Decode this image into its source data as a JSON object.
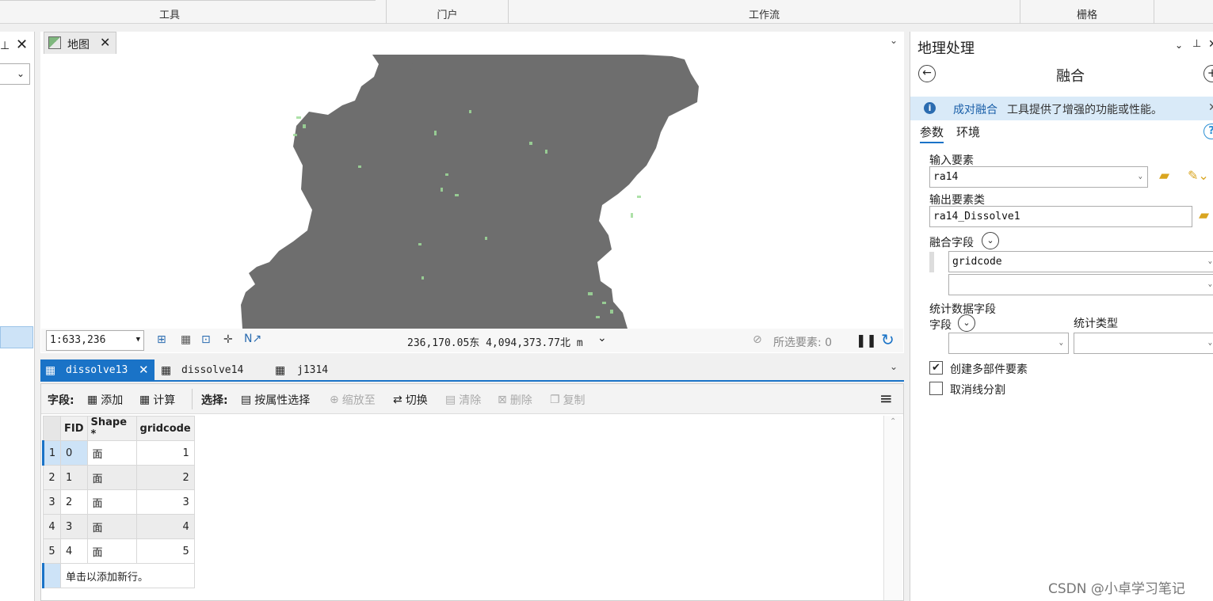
{
  "ribbon": {
    "groups": [
      "工具",
      "门户",
      "工作流",
      "栅格"
    ]
  },
  "map": {
    "tab_label": "地图",
    "scale": "1:633,236",
    "coords": "236,170.05东  4,094,373.77北 m",
    "selected_label": "所选要素: 0"
  },
  "table": {
    "tabs": [
      "dissolve13",
      "dissolve14",
      "j1314"
    ],
    "toolbar": {
      "field_label": "字段:",
      "add": "添加",
      "calculate": "计算",
      "select_label": "选择:",
      "select_by_attr": "按属性选择",
      "zoom_to": "缩放至",
      "switch": "切换",
      "clear": "清除",
      "delete": "删除",
      "copy": "复制"
    },
    "columns": [
      "FID",
      "Shape *",
      "gridcode"
    ],
    "rows": [
      {
        "num": "1",
        "fid": "0",
        "shape": "面",
        "gridcode": "1"
      },
      {
        "num": "2",
        "fid": "1",
        "shape": "面",
        "gridcode": "2"
      },
      {
        "num": "3",
        "fid": "2",
        "shape": "面",
        "gridcode": "3"
      },
      {
        "num": "4",
        "fid": "3",
        "shape": "面",
        "gridcode": "4"
      },
      {
        "num": "5",
        "fid": "4",
        "shape": "面",
        "gridcode": "5"
      }
    ],
    "add_row_hint": "单击以添加新行。"
  },
  "gp": {
    "panel_title": "地理处理",
    "tool_title": "融合",
    "info_link": "成对融合",
    "info_text": "工具提供了增强的功能或性能。",
    "tabs": [
      "参数",
      "环境"
    ],
    "input_label": "输入要素",
    "input_value": "ra14",
    "output_label": "输出要素类",
    "output_value": "ra14_Dissolve1",
    "dissolve_field_label": "融合字段",
    "dissolve_field_value": "gridcode",
    "stats_label": "统计数据字段",
    "field_label": "字段",
    "stat_type_label": "统计类型",
    "multipart_label": "创建多部件要素",
    "multipart_checked": true,
    "unsplit_label": "取消线分割",
    "unsplit_checked": false
  },
  "watermark": "CSDN @小卓学习笔记"
}
